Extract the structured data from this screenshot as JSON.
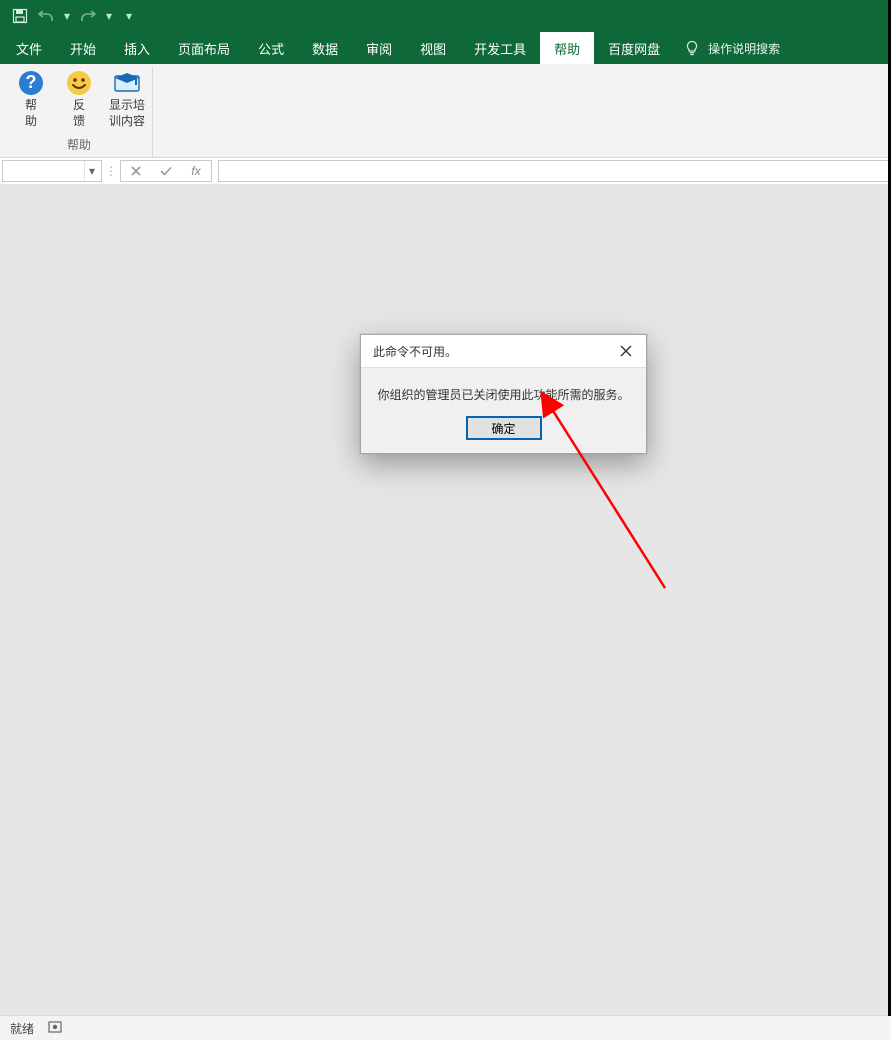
{
  "menus": {
    "items": [
      "文件",
      "开始",
      "插入",
      "页面布局",
      "公式",
      "数据",
      "审阅",
      "视图",
      "开发工具",
      "帮助",
      "百度网盘"
    ],
    "active_index": 9,
    "tell_me": "操作说明搜索"
  },
  "ribbon": {
    "group_label": "帮助",
    "buttons": [
      {
        "label_l1": "帮",
        "label_l2": "助",
        "icon": "help-circle-icon"
      },
      {
        "label_l1": "反",
        "label_l2": "馈",
        "icon": "smiley-icon"
      },
      {
        "label_l1": "显示培",
        "label_l2": "训内容",
        "icon": "training-icon"
      }
    ]
  },
  "formula_bar": {
    "name_box_value": "",
    "fx_label": "fx",
    "formula_value": ""
  },
  "dialog": {
    "title": "此命令不可用。",
    "message": "你组织的管理员已关闭使用此功能所需的服务。",
    "ok_label": "确定"
  },
  "statusbar": {
    "left": "就绪"
  }
}
